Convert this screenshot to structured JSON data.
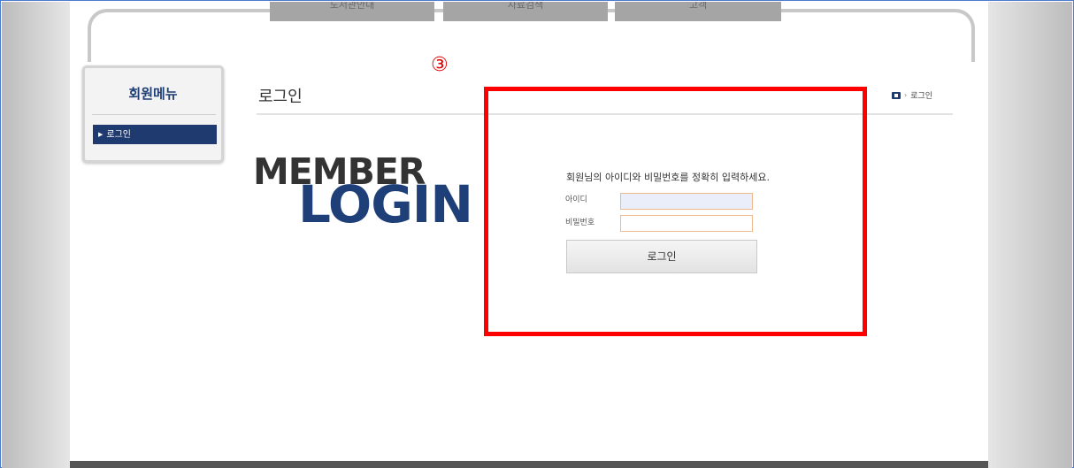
{
  "nav": {
    "tabs": [
      {
        "label": "도서관안내"
      },
      {
        "label": "자료검색"
      },
      {
        "label": "고객"
      }
    ]
  },
  "annotation": {
    "step_marker": "③",
    "highlight_color": "#ff0000"
  },
  "sidebar": {
    "title": "회원메뉴",
    "items": [
      {
        "label": "로그인",
        "active": true
      }
    ]
  },
  "page": {
    "title": "로그인"
  },
  "breadcrumb": {
    "home_icon": "home-icon",
    "separator": "›",
    "current": "로그인"
  },
  "hero": {
    "line1": "MEMBER",
    "line2": "LOGIN"
  },
  "login_form": {
    "description": "회원님의 아이디와 비밀번호를 정확히 입력하세요.",
    "id_label": "아이디",
    "id_value": "",
    "password_label": "비밀번호",
    "password_value": "",
    "submit_label": "로그인"
  },
  "colors": {
    "brand": "#1e3a6e",
    "input_border": "#f0b98c"
  }
}
